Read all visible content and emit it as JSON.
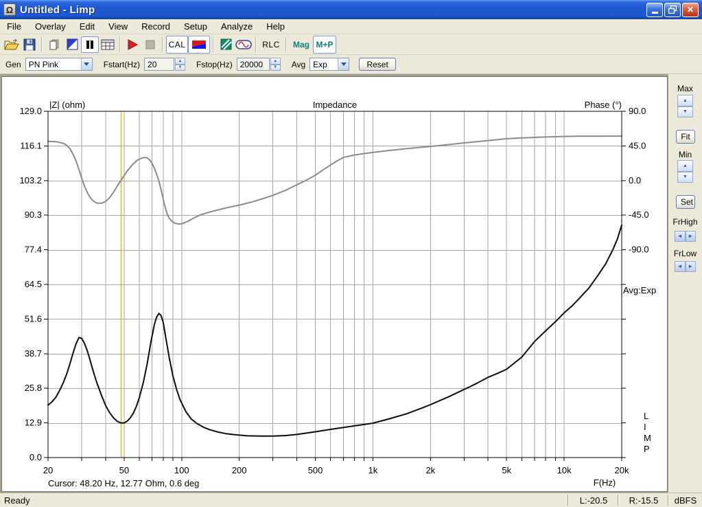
{
  "window": {
    "title": "Untitled - Limp",
    "app_icon": "Ω"
  },
  "menu": {
    "items": [
      "File",
      "Overlay",
      "Edit",
      "View",
      "Record",
      "Setup",
      "Analyze",
      "Help"
    ]
  },
  "toolbar": {
    "cal_label": "CAL",
    "rlc_label": "RLC",
    "mag_label": "Mag",
    "mp_label": "M+P"
  },
  "controls": {
    "gen_label": "Gen",
    "gen_value": "PN Pink",
    "fstart_label": "Fstart(Hz)",
    "fstart_value": "20",
    "fstop_label": "Fstop(Hz)",
    "fstop_value": "20000",
    "avg_label": "Avg",
    "avg_value": "Exp",
    "reset_label": "Reset"
  },
  "side_panel": {
    "max_label": "Max",
    "fit_label": "Fit",
    "min_label": "Min",
    "set_label": "Set",
    "frhigh_label": "FrHigh",
    "frlow_label": "FrLow"
  },
  "statusbar": {
    "ready": "Ready",
    "left_level": "L:-20.5",
    "right_level": "R:-15.5",
    "unit": "dBFS"
  },
  "chart_data": {
    "type": "line",
    "title": "Impedance",
    "grid_color": "#a6a6a6",
    "background": "#ffffff",
    "left_axis": {
      "label": "|Z| (ohm)",
      "min": 0,
      "max": 129,
      "tick_values": [
        129,
        116.1,
        103.2,
        90.3,
        77.4,
        64.5,
        51.6,
        38.7,
        25.8,
        12.9,
        0
      ],
      "tick_labels": [
        "129.0",
        "116.1",
        "103.2",
        "90.3",
        "77.4",
        "64.5",
        "51.6",
        "38.7",
        "25.8",
        "12.9",
        "0.0"
      ]
    },
    "right_axis": {
      "label": "Phase (°)",
      "deg_per_division": 45,
      "tick_values": [
        90,
        45,
        0,
        -45,
        -90
      ],
      "tick_labels": [
        "90.0",
        "45.0",
        "0.0",
        "-45.0",
        "-90.0"
      ]
    },
    "x_axis": {
      "label": "F(Hz)",
      "scale": "log",
      "min": 20,
      "max": 20000,
      "labeled_tick_values": [
        20,
        50,
        100,
        200,
        500,
        1000,
        2000,
        5000,
        10000,
        20000
      ],
      "labeled_tick_labels": [
        "20",
        "50",
        "100",
        "200",
        "500",
        "1k",
        "2k",
        "5k",
        "10k",
        "20k"
      ],
      "grid_freqs": [
        30,
        40,
        50,
        60,
        70,
        80,
        90,
        100,
        200,
        300,
        400,
        500,
        600,
        700,
        800,
        900,
        1000,
        2000,
        3000,
        4000,
        5000,
        6000,
        7000,
        8000,
        9000,
        10000
      ]
    },
    "cursor": {
      "freq_hz": 48.2,
      "color": "#d2c400",
      "text": "Cursor: 48.20 Hz, 12.77 Ohm, 0.6 deg"
    },
    "annotations": {
      "avg_mode": "Avg:Exp",
      "vertical_logo": "LIMP"
    },
    "series": [
      {
        "name": "impedance-magnitude",
        "axis": "left",
        "color": "#0b0b0b",
        "width": 2,
        "points": [
          [
            20,
            19.5
          ],
          [
            21,
            20.8
          ],
          [
            22,
            22.5
          ],
          [
            23,
            25
          ],
          [
            24,
            27.8
          ],
          [
            25,
            31
          ],
          [
            26,
            34.8
          ],
          [
            27,
            38.8
          ],
          [
            28,
            42.3
          ],
          [
            29,
            44.7
          ],
          [
            30,
            44.4
          ],
          [
            31,
            42.6
          ],
          [
            32,
            40
          ],
          [
            33,
            36.9
          ],
          [
            34,
            33.6
          ],
          [
            35,
            30.6
          ],
          [
            36,
            27.9
          ],
          [
            38,
            23.3
          ],
          [
            40,
            19.4
          ],
          [
            42,
            16.7
          ],
          [
            44,
            14.8
          ],
          [
            46,
            13.5
          ],
          [
            48,
            12.9
          ],
          [
            50,
            12.9
          ],
          [
            52,
            13.6
          ],
          [
            54,
            14.9
          ],
          [
            56,
            16.7
          ],
          [
            58,
            19.2
          ],
          [
            60,
            22.3
          ],
          [
            63,
            28
          ],
          [
            66,
            35
          ],
          [
            69,
            43
          ],
          [
            72,
            49.6
          ],
          [
            74,
            52.4
          ],
          [
            76,
            53.7
          ],
          [
            78,
            52.9
          ],
          [
            80,
            50.4
          ],
          [
            83,
            43.8
          ],
          [
            86,
            37.4
          ],
          [
            90,
            30.4
          ],
          [
            94,
            25.4
          ],
          [
            98,
            21.6
          ],
          [
            105,
            17.2
          ],
          [
            112,
            14.4
          ],
          [
            120,
            12.7
          ],
          [
            130,
            11.3
          ],
          [
            140,
            10.4
          ],
          [
            155,
            9.5
          ],
          [
            170,
            8.9
          ],
          [
            190,
            8.5
          ],
          [
            220,
            8.1
          ],
          [
            260,
            8
          ],
          [
            300,
            8
          ],
          [
            350,
            8.2
          ],
          [
            400,
            8.6
          ],
          [
            450,
            9.1
          ],
          [
            500,
            9.6
          ],
          [
            600,
            10.5
          ],
          [
            700,
            11.2
          ],
          [
            800,
            11.8
          ],
          [
            900,
            12.3
          ],
          [
            1000,
            12.8
          ],
          [
            1200,
            14.3
          ],
          [
            1500,
            16.3
          ],
          [
            1800,
            18.4
          ],
          [
            2000,
            19.7
          ],
          [
            2500,
            22.7
          ],
          [
            3000,
            25.4
          ],
          [
            3200,
            26.3
          ],
          [
            3500,
            27.7
          ],
          [
            4000,
            29.9
          ],
          [
            4500,
            31.4
          ],
          [
            5000,
            32.9
          ],
          [
            6000,
            37.4
          ],
          [
            7000,
            43.2
          ],
          [
            8000,
            47.2
          ],
          [
            9000,
            50.6
          ],
          [
            10000,
            53.9
          ],
          [
            11000,
            56.5
          ],
          [
            12000,
            59.3
          ],
          [
            13500,
            63.2
          ],
          [
            15000,
            67.8
          ],
          [
            16500,
            72.2
          ],
          [
            18000,
            77.5
          ],
          [
            19000,
            81.5
          ],
          [
            20000,
            86.6
          ]
        ]
      },
      {
        "name": "phase",
        "axis": "phase",
        "color": "#8a8a8a",
        "width": 2,
        "points": [
          [
            20,
            51
          ],
          [
            22,
            50.5
          ],
          [
            24,
            48.5
          ],
          [
            25,
            46
          ],
          [
            26,
            41.5
          ],
          [
            27,
            34.5
          ],
          [
            28,
            25.5
          ],
          [
            29,
            14.5
          ],
          [
            30,
            3
          ],
          [
            31,
            -7
          ],
          [
            32,
            -15
          ],
          [
            33,
            -21
          ],
          [
            34,
            -25
          ],
          [
            35,
            -27.8
          ],
          [
            36,
            -29.3
          ],
          [
            38,
            -29.5
          ],
          [
            40,
            -27.2
          ],
          [
            42,
            -22.3
          ],
          [
            44,
            -15.2
          ],
          [
            46,
            -7.2
          ],
          [
            48.2,
            0.6
          ],
          [
            50,
            6.5
          ],
          [
            52,
            12.5
          ],
          [
            55,
            20
          ],
          [
            58,
            25.8
          ],
          [
            61,
            28.7
          ],
          [
            64,
            30
          ],
          [
            66,
            29.4
          ],
          [
            68,
            26.8
          ],
          [
            70,
            22.4
          ],
          [
            72,
            16
          ],
          [
            74,
            8.2
          ],
          [
            76,
            -0.5
          ],
          [
            78,
            -12
          ],
          [
            80,
            -24
          ],
          [
            82,
            -35
          ],
          [
            84,
            -43.5
          ],
          [
            86,
            -48.8
          ],
          [
            89,
            -53
          ],
          [
            92,
            -55.4
          ],
          [
            96,
            -56.4
          ],
          [
            100,
            -56.2
          ],
          [
            107,
            -53.3
          ],
          [
            115,
            -49
          ],
          [
            125,
            -44.6
          ],
          [
            140,
            -41
          ],
          [
            160,
            -37.2
          ],
          [
            180,
            -34.3
          ],
          [
            200,
            -32
          ],
          [
            230,
            -28.2
          ],
          [
            260,
            -24.3
          ],
          [
            300,
            -19.2
          ],
          [
            350,
            -12.6
          ],
          [
            400,
            -5.5
          ],
          [
            450,
            0.6
          ],
          [
            500,
            7
          ],
          [
            550,
            14
          ],
          [
            600,
            20.2
          ],
          [
            650,
            25.6
          ],
          [
            700,
            30
          ],
          [
            800,
            33.2
          ],
          [
            900,
            35.1
          ],
          [
            1000,
            36.5
          ],
          [
            1200,
            38.9
          ],
          [
            1500,
            41.4
          ],
          [
            2000,
            44.4
          ],
          [
            2500,
            46.8
          ],
          [
            3000,
            48.9
          ],
          [
            4000,
            52
          ],
          [
            5000,
            54.4
          ],
          [
            6000,
            55.4
          ],
          [
            7000,
            56.1
          ],
          [
            8000,
            56.6
          ],
          [
            9000,
            57
          ],
          [
            10000,
            57.3
          ],
          [
            12000,
            57.6
          ],
          [
            15000,
            57.7
          ],
          [
            18000,
            57.8
          ],
          [
            20000,
            57.8
          ]
        ]
      }
    ]
  }
}
